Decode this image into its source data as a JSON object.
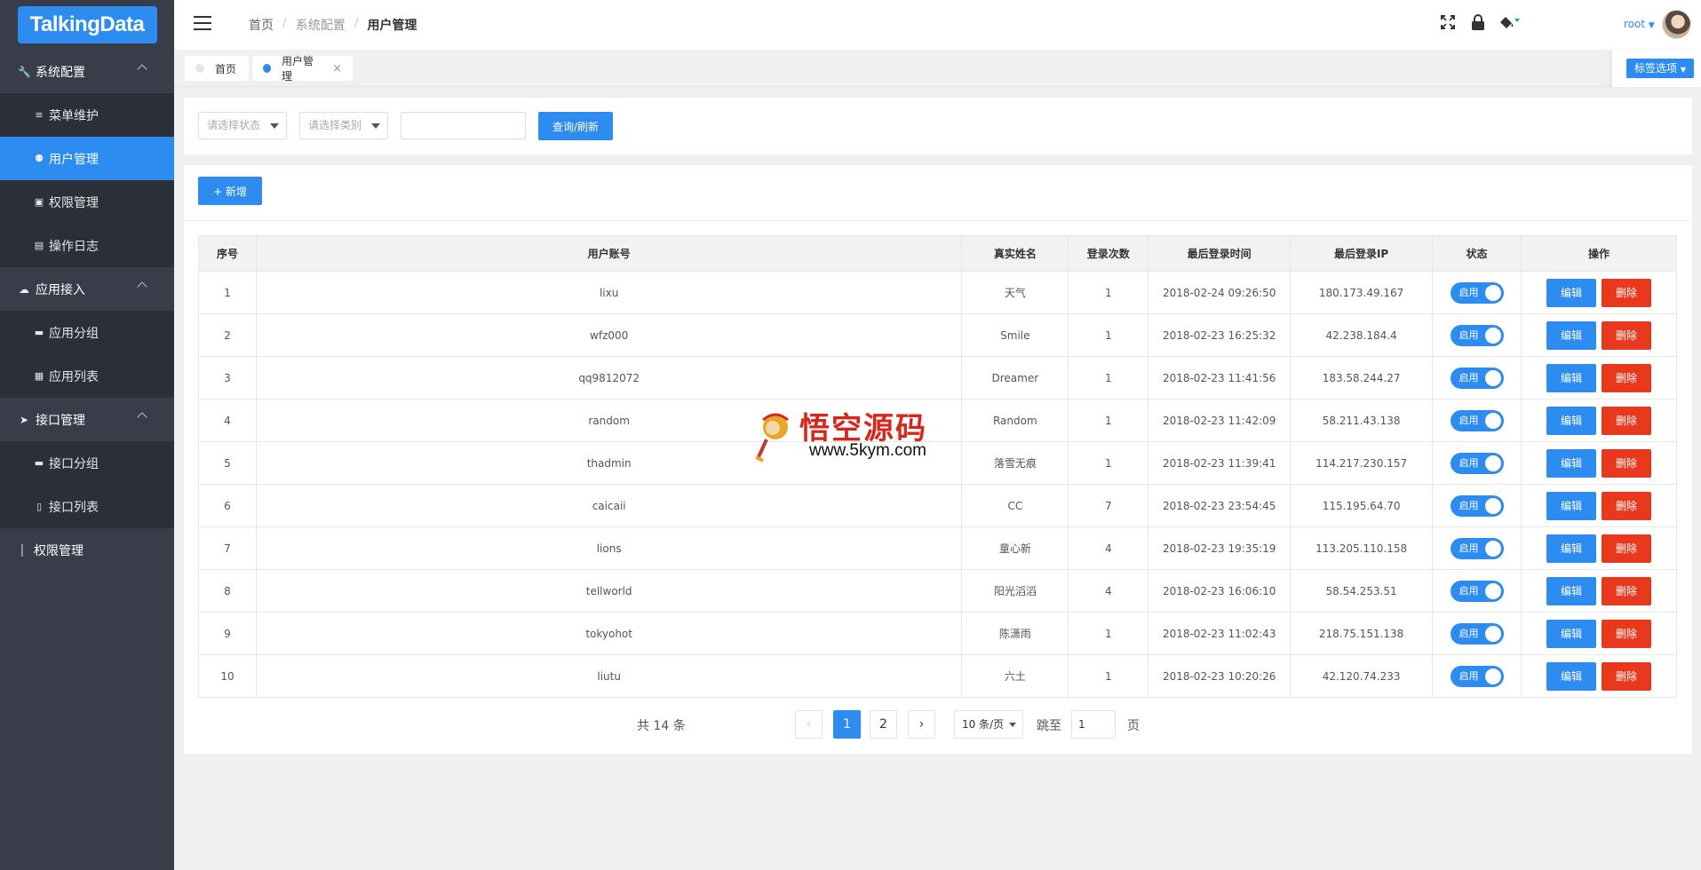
{
  "logo": {
    "text": "TalkingData"
  },
  "sidebar": {
    "groups": [
      {
        "label": "系统配置",
        "icon": "wrench-icon",
        "children": [
          {
            "label": "菜单维护",
            "icon": "menu-list-icon"
          },
          {
            "label": "用户管理",
            "icon": "users-icon",
            "active": true
          },
          {
            "label": "权限管理",
            "icon": "lock-icon"
          },
          {
            "label": "操作日志",
            "icon": "log-icon"
          }
        ]
      },
      {
        "label": "应用接入",
        "icon": "cloud-icon",
        "children": [
          {
            "label": "应用分组",
            "icon": "folder-icon"
          },
          {
            "label": "应用列表",
            "icon": "list-icon"
          }
        ]
      },
      {
        "label": "接口管理",
        "icon": "send-icon",
        "children": [
          {
            "label": "接口分组",
            "icon": "folder-icon"
          },
          {
            "label": "接口列表",
            "icon": "file-icon"
          }
        ]
      },
      {
        "label": "权限管理",
        "icon": "thermometer-icon",
        "children": []
      }
    ]
  },
  "header": {
    "breadcrumb": [
      "首页",
      "系统配置",
      "用户管理"
    ],
    "user": "root",
    "icons": [
      "fullscreen-icon",
      "lock-icon",
      "paint-bucket-icon"
    ]
  },
  "tabs": {
    "items": [
      {
        "label": "首页",
        "active": false
      },
      {
        "label": "用户管理",
        "active": true,
        "close": "×"
      }
    ],
    "options_label": "标签选项"
  },
  "filters": {
    "status_placeholder": "请选择状态",
    "category_placeholder": "请选择类别",
    "keyword_value": "",
    "query_button": "查询/刷新"
  },
  "toolbar": {
    "add_button": "+ 新增"
  },
  "table": {
    "headers": [
      "序号",
      "用户账号",
      "真实姓名",
      "登录次数",
      "最后登录时间",
      "最后登录IP",
      "状态",
      "操作"
    ],
    "status_label": "启用",
    "edit_label": "编辑",
    "delete_label": "删除",
    "rows": [
      {
        "no": "1",
        "account": "lixu",
        "name": "天气",
        "count": "1",
        "time": "2018-02-24 09:26:50",
        "ip": "180.173.49.167"
      },
      {
        "no": "2",
        "account": "wfz000",
        "name": "Smile",
        "count": "1",
        "time": "2018-02-23 16:25:32",
        "ip": "42.238.184.4"
      },
      {
        "no": "3",
        "account": "qq9812072",
        "name": "Dreamer",
        "count": "1",
        "time": "2018-02-23 11:41:56",
        "ip": "183.58.244.27"
      },
      {
        "no": "4",
        "account": "random",
        "name": "Random",
        "count": "1",
        "time": "2018-02-23 11:42:09",
        "ip": "58.211.43.138"
      },
      {
        "no": "5",
        "account": "thadmin",
        "name": "落雪无痕",
        "count": "1",
        "time": "2018-02-23 11:39:41",
        "ip": "114.217.230.157"
      },
      {
        "no": "6",
        "account": "caicaii",
        "name": "CC",
        "count": "7",
        "time": "2018-02-23 23:54:45",
        "ip": "115.195.64.70"
      },
      {
        "no": "7",
        "account": "lions",
        "name": "童心新",
        "count": "4",
        "time": "2018-02-23 19:35:19",
        "ip": "113.205.110.158"
      },
      {
        "no": "8",
        "account": "tellworld",
        "name": "阳光滔滔",
        "count": "4",
        "time": "2018-02-23 16:06:10",
        "ip": "58.54.253.51"
      },
      {
        "no": "9",
        "account": "tokyohot",
        "name": "陈潇雨",
        "count": "1",
        "time": "2018-02-23 11:02:43",
        "ip": "218.75.151.138"
      },
      {
        "no": "10",
        "account": "liutu",
        "name": "六土",
        "count": "1",
        "time": "2018-02-23 10:20:26",
        "ip": "42.120.74.233"
      }
    ]
  },
  "pager": {
    "total": "共 14 条",
    "prev": "‹",
    "pages": [
      "1",
      "2"
    ],
    "current": "1",
    "next": "›",
    "per_page": "10 条/页",
    "goto_label": "跳至",
    "goto_value": "1",
    "page_suffix": "页"
  },
  "watermark": {
    "title": "悟空源码",
    "url": "www.5kym.com"
  },
  "colors": {
    "accent": "#2d8cf0",
    "danger": "#e8391c",
    "sidebar": "#393d49",
    "sidebar_child": "#2b2f3a"
  }
}
